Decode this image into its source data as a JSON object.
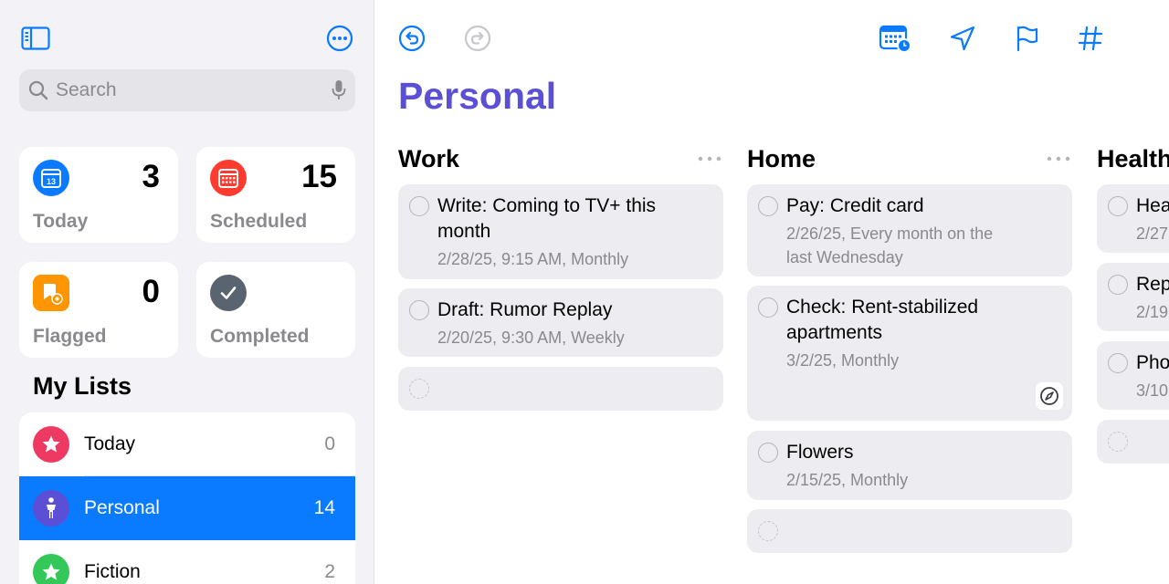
{
  "search": {
    "placeholder": "Search"
  },
  "smart_lists": [
    {
      "label": "Today",
      "count": "3",
      "color": "#0a7aff",
      "icon": "calendar-13-icon",
      "icon_text": "13"
    },
    {
      "label": "Scheduled",
      "count": "15",
      "color": "#ff3b30",
      "icon": "calendar-grid-icon"
    },
    {
      "label": "Flagged",
      "count": "0",
      "color": "#ff9500",
      "icon": "flagged-person-icon"
    },
    {
      "label": "Completed",
      "count": "",
      "color": "#5a6470",
      "icon": "checkmark-icon"
    }
  ],
  "my_lists": {
    "title": "My Lists",
    "items": [
      {
        "name": "Today",
        "count": "0",
        "color": "#ee3a62",
        "icon": "star-icon"
      },
      {
        "name": "Personal",
        "count": "14",
        "color": "#5b4fd5",
        "icon": "person-icon"
      },
      {
        "name": "Fiction",
        "count": "2",
        "color": "#34c759",
        "icon": "star-icon"
      }
    ]
  },
  "main": {
    "title": "Personal",
    "title_color": "#5b4fd5",
    "accent": "#0a7aff",
    "columns": [
      {
        "title": "Work",
        "tasks": [
          {
            "title": "Write: Coming to TV+ this month",
            "subtitle": "2/28/25, 9:15 AM, Monthly"
          },
          {
            "title": "Draft: Rumor Replay",
            "subtitle": "2/20/25, 9:30 AM, Weekly"
          }
        ]
      },
      {
        "title": "Home",
        "tasks": [
          {
            "title": "Pay: Credit card",
            "subtitle": "2/26/25, Every month on the last Wednesday"
          },
          {
            "title": "Check: Rent-stabilized apartments",
            "subtitle": "3/2/25, Monthly"
          },
          {
            "title": "Flowers",
            "subtitle": "2/15/25, Monthly"
          }
        ]
      },
      {
        "title": "Health",
        "tasks": [
          {
            "title": "Hea",
            "subtitle": "2/27"
          },
          {
            "title": "Rep",
            "subtitle": "2/19"
          },
          {
            "title": "Pho",
            "subtitle": "3/10"
          }
        ]
      }
    ]
  }
}
